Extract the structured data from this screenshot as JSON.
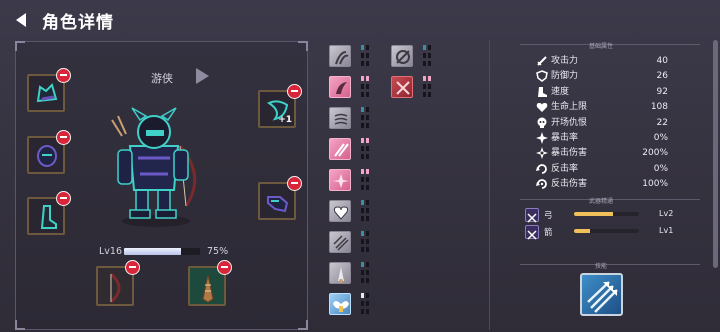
{
  "header": {
    "title": "角色详情",
    "back_icon": "back-arrow-icon"
  },
  "character": {
    "class_name": "游侠",
    "level_label": "Lv16",
    "xp_percent_label": "75%",
    "xp_fraction": 0.75,
    "equipment_left": [
      {
        "slot": "helmet",
        "icon": "helmet-icon"
      },
      {
        "slot": "armor",
        "icon": "armor-icon"
      },
      {
        "slot": "boots",
        "icon": "boots-icon"
      }
    ],
    "equipment_right": [
      {
        "slot": "cape",
        "icon": "cape-icon",
        "bonus": "+1"
      },
      {
        "slot": "gloves",
        "icon": "gloves-icon"
      }
    ],
    "weapons": [
      {
        "slot": "bow",
        "icon": "bow-icon",
        "bg": "#2f2b30"
      },
      {
        "slot": "arrow",
        "icon": "arrow-icon",
        "bg": "#1e4a3e"
      }
    ]
  },
  "items": [
    {
      "icon": "claw-icon",
      "color": "gray"
    },
    {
      "icon": "rune-icon",
      "color": "gray"
    },
    {
      "icon": "horn-icon",
      "color": "pink"
    },
    {
      "icon": "crossed-blades-icon",
      "color": "red"
    },
    {
      "icon": "wind-icon",
      "color": "gray"
    },
    {
      "icon": "slash-icon",
      "color": "pink"
    },
    {
      "icon": "shuriken-icon",
      "color": "pink"
    },
    {
      "icon": "heart-shield-icon",
      "color": "gray"
    },
    {
      "icon": "scratch-icon",
      "color": "gray"
    },
    {
      "icon": "spike-icon",
      "color": "gray"
    },
    {
      "icon": "wings-icon",
      "color": "blue"
    }
  ],
  "stats": {
    "section_title": "基础属性",
    "rows": [
      {
        "icon": "sword-icon",
        "label": "攻击力",
        "value": "40"
      },
      {
        "icon": "shield-icon",
        "label": "防御力",
        "value": "26"
      },
      {
        "icon": "boot-speed-icon",
        "label": "速度",
        "value": "92"
      },
      {
        "icon": "heart-icon",
        "label": "生命上限",
        "value": "108"
      },
      {
        "icon": "skull-icon",
        "label": "开场仇恨",
        "value": "22"
      },
      {
        "icon": "crit-icon",
        "label": "暴击率",
        "value": "0%"
      },
      {
        "icon": "crit-damage-icon",
        "label": "暴击伤害",
        "value": "200%"
      },
      {
        "icon": "counter-icon",
        "label": "反击率",
        "value": "0%"
      },
      {
        "icon": "counter-damage-icon",
        "label": "反击伤害",
        "value": "100%"
      }
    ]
  },
  "weapon_mastery": {
    "section_title": "武器精通",
    "rows": [
      {
        "icon": "bow-mastery-icon",
        "label": "弓",
        "level": "Lv2",
        "progress": 0.6
      },
      {
        "icon": "arrow-mastery-icon",
        "label": "箭",
        "level": "Lv1",
        "progress": 0.25
      }
    ]
  },
  "skills": {
    "section_title": "技能",
    "slot_icon": "multi-arrow-skill-icon"
  }
}
